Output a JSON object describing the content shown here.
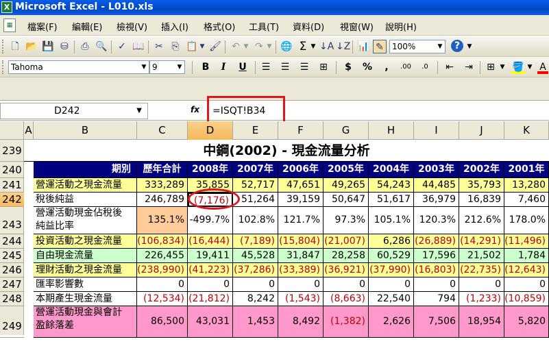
{
  "window": {
    "title": "Microsoft Excel - L010.xls"
  },
  "menu": [
    "檔案(F)",
    "編輯(E)",
    "檢視(V)",
    "插入(I)",
    "格式(O)",
    "工具(T)",
    "資料(D)",
    "視窗(W)",
    "說明(H)"
  ],
  "toolbar": {
    "zoom": "100%",
    "font": "Tahoma",
    "size": "9"
  },
  "formula": {
    "cell": "D242",
    "fx": "fx",
    "text": "=ISQT!B34"
  },
  "columns": [
    "A",
    "B",
    "C",
    "D",
    "E",
    "F",
    "G",
    "H",
    "I",
    "J",
    "K"
  ],
  "rows": [
    "239",
    "240",
    "241",
    "242",
    "243",
    "244",
    "245",
    "246",
    "247",
    "248",
    "249"
  ],
  "sheet": {
    "title": "中鋼(2002) - 現金流量分析",
    "header": [
      "期別",
      "歷年合計",
      "2008年",
      "2007年",
      "2006年",
      "2005年",
      "2004年",
      "2003年",
      "2002年",
      "2001年"
    ],
    "data": [
      {
        "label": "營運活動之現金流量",
        "values": [
          "333,289",
          "35,855",
          "52,717",
          "47,651",
          "49,265",
          "54,243",
          "44,485",
          "35,793",
          "13,280"
        ]
      },
      {
        "label": "稅後純益",
        "values": [
          "246,789",
          "(7,176)",
          "51,264",
          "39,159",
          "50,647",
          "51,617",
          "36,979",
          "16,839",
          "7,460"
        ]
      },
      {
        "label": "營運活動現金佔稅後",
        "label2": "純益比率",
        "values": [
          "135.1%",
          "-499.7%",
          "102.8%",
          "121.7%",
          "97.3%",
          "105.1%",
          "120.3%",
          "212.6%",
          "178.0%"
        ]
      },
      {
        "label": "投資活動之現金流量",
        "values": [
          "(106,834)",
          "(16,444)",
          "(7,189)",
          "(15,804)",
          "(21,007)",
          "6,286",
          "(26,889)",
          "(14,291)",
          "(11,496)"
        ]
      },
      {
        "label": "自由現金流量",
        "values": [
          "226,455",
          "19,411",
          "45,528",
          "31,847",
          "28,258",
          "60,529",
          "17,596",
          "21,502",
          "1,784"
        ]
      },
      {
        "label": "理財活動之現金流量",
        "values": [
          "(238,990)",
          "(41,223)",
          "(37,286)",
          "(33,389)",
          "(36,921)",
          "(37,990)",
          "(16,803)",
          "(22,735)",
          "(12,643)"
        ]
      },
      {
        "label": "匯率影響數",
        "values": [
          "0",
          "0",
          "0",
          "0",
          "0",
          "0",
          "0",
          "0",
          "0"
        ]
      },
      {
        "label": "本期產生現金流量",
        "values": [
          "(12,534)",
          "(21,812)",
          "8,242",
          "(1,543)",
          "(8,663)",
          "22,540",
          "794",
          "(1,233)",
          "(10,859)"
        ]
      },
      {
        "label": "營運活動現金與會計",
        "label2": "盈餘落差",
        "values": [
          "86,500",
          "43,031",
          "1,453",
          "8,492",
          "(1,382)",
          "2,626",
          "7,506",
          "18,954",
          "5,820"
        ]
      }
    ]
  },
  "colors": {
    "header": "#000080",
    "yellow": "#ffff99",
    "green": "#ccffcc",
    "pink": "#ff99cc",
    "orange": "#ffcc99",
    "highlight": "#e2141c"
  }
}
